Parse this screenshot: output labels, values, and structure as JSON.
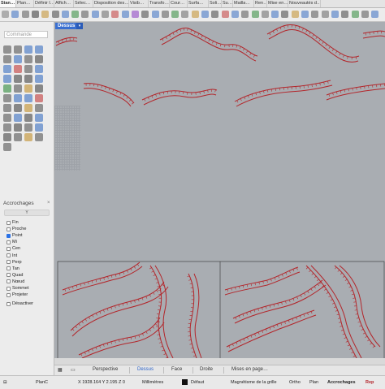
{
  "tabs": [
    "Stan…",
    "Plan…",
    "Définir l…",
    "Affich…",
    "Sélec…",
    "Disposition des…",
    "Visib…",
    "Transfo…",
    "Cour…",
    "Surfa…",
    "Soli…",
    "Su…",
    "Mailla…",
    "Ren…",
    "Mise en…",
    "Nouveautés d…"
  ],
  "command": {
    "placeholder": "Commande"
  },
  "accrochages": {
    "title": "Accrochages",
    "close": "×",
    "filter": "Y",
    "items": [
      {
        "label": "Fin",
        "checked": false
      },
      {
        "label": "Proche",
        "checked": false
      },
      {
        "label": "Point",
        "checked": true
      },
      {
        "label": "Mi",
        "checked": false
      },
      {
        "label": "Cen",
        "checked": false
      },
      {
        "label": "Int",
        "checked": false
      },
      {
        "label": "Perp",
        "checked": false
      },
      {
        "label": "Tan",
        "checked": false
      },
      {
        "label": "Quad",
        "checked": false
      },
      {
        "label": "Nœud",
        "checked": false
      },
      {
        "label": "Sommet",
        "checked": false
      },
      {
        "label": "Projeter",
        "checked": false
      }
    ],
    "disable": "Désactiver"
  },
  "viewport": {
    "label": "Dessus",
    "arrow": "▾"
  },
  "viewtabs": [
    "Perspective",
    "Dessus",
    "Face",
    "Droite",
    "Mises en page…"
  ],
  "viewtab_active": "Dessus",
  "status": {
    "plane": "PlanC",
    "coords": "X 1928.164 Y 2.195 Z 0",
    "units": "Millimètres",
    "layer": "Défaut",
    "grid_snap": "Magnétisme de la grille",
    "ortho": "Ortho",
    "planar": "Plan",
    "osnap": "Accrochages",
    "more": "Rep"
  },
  "colors": {
    "accent": "#2b72e6",
    "curve": "#b3252a",
    "viewport_bg": "#a9adb2"
  }
}
